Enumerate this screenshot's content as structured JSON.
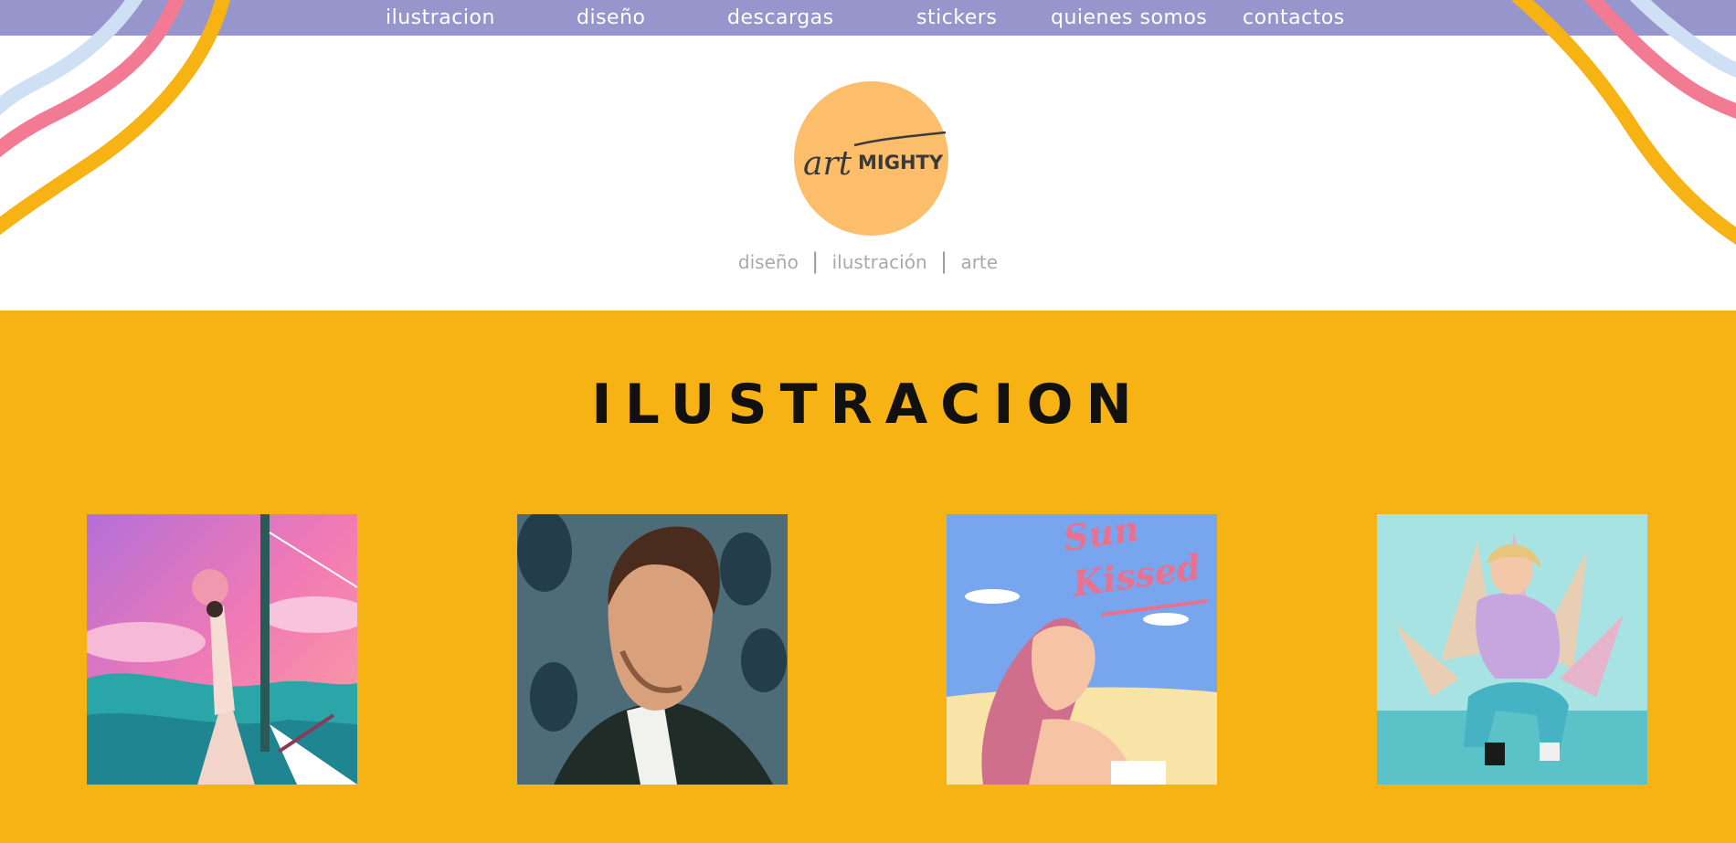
{
  "nav": {
    "items": [
      {
        "label": "ilustracion"
      },
      {
        "label": "diseño"
      },
      {
        "label": "descargas"
      },
      {
        "label": "stickers"
      },
      {
        "label": "quienes somos"
      },
      {
        "label": "contactos"
      }
    ]
  },
  "logo": {
    "text_script": "art",
    "text_bold": "MIGHTY"
  },
  "tagline": {
    "part1": "diseño",
    "part2": "ilustración",
    "part3": "arte",
    "separator": "|"
  },
  "section": {
    "title": "ILUSTRACION"
  },
  "gallery": {
    "sun_kissed_line1": "Sun",
    "sun_kissed_line2": "Kissed"
  },
  "colors": {
    "nav_bg": "#9696cc",
    "section_bg": "#f7b213",
    "logo_circle": "#fdbe6c",
    "ribbon_blue": "#cfe0f4",
    "ribbon_pink": "#f27a93",
    "ribbon_yellow": "#f7b213"
  }
}
